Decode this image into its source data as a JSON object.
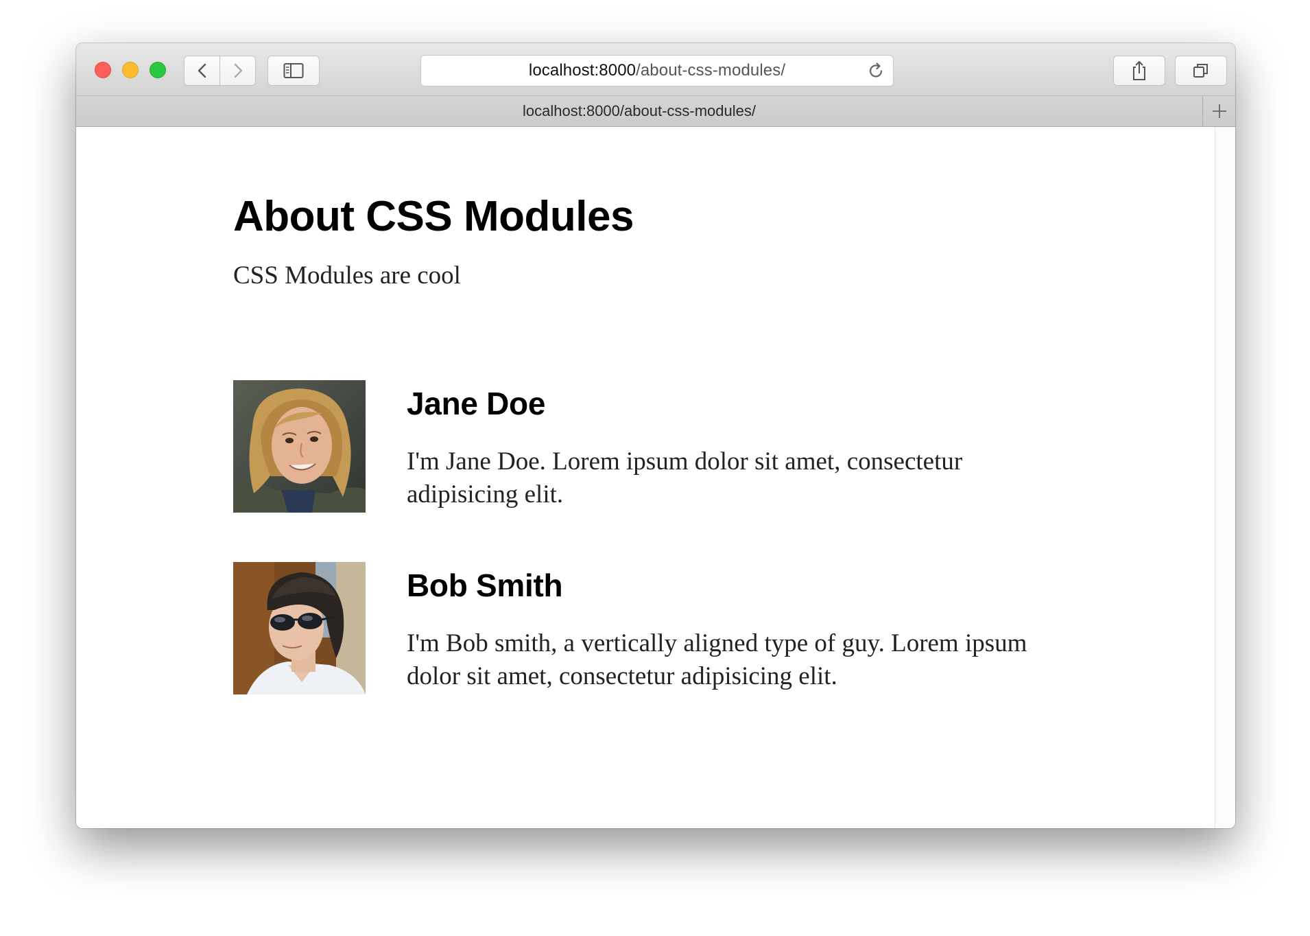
{
  "browser": {
    "url_host": "localhost:8000",
    "url_path": "/about-css-modules/",
    "tab_title": "localhost:8000/about-css-modules/",
    "icons": {
      "back": "chevron-left-icon",
      "forward": "chevron-right-icon",
      "sidebar": "sidebar-icon",
      "reload": "reload-icon",
      "share": "share-icon",
      "tabs": "tabs-overview-icon",
      "new_tab": "plus-icon"
    },
    "colors": {
      "close": "#fc5f57",
      "minimize": "#fdbc2e",
      "maximize": "#29c840"
    }
  },
  "page": {
    "title": "About CSS Modules",
    "intro": "CSS Modules are cool",
    "people": [
      {
        "name": "Jane Doe",
        "bio": "I'm Jane Doe. Lorem ipsum dolor sit amet, consectetur adipisicing elit."
      },
      {
        "name": "Bob Smith",
        "bio": "I'm Bob smith, a vertically aligned type of guy. Lorem ipsum dolor sit amet, consectetur adipisicing elit."
      }
    ]
  }
}
